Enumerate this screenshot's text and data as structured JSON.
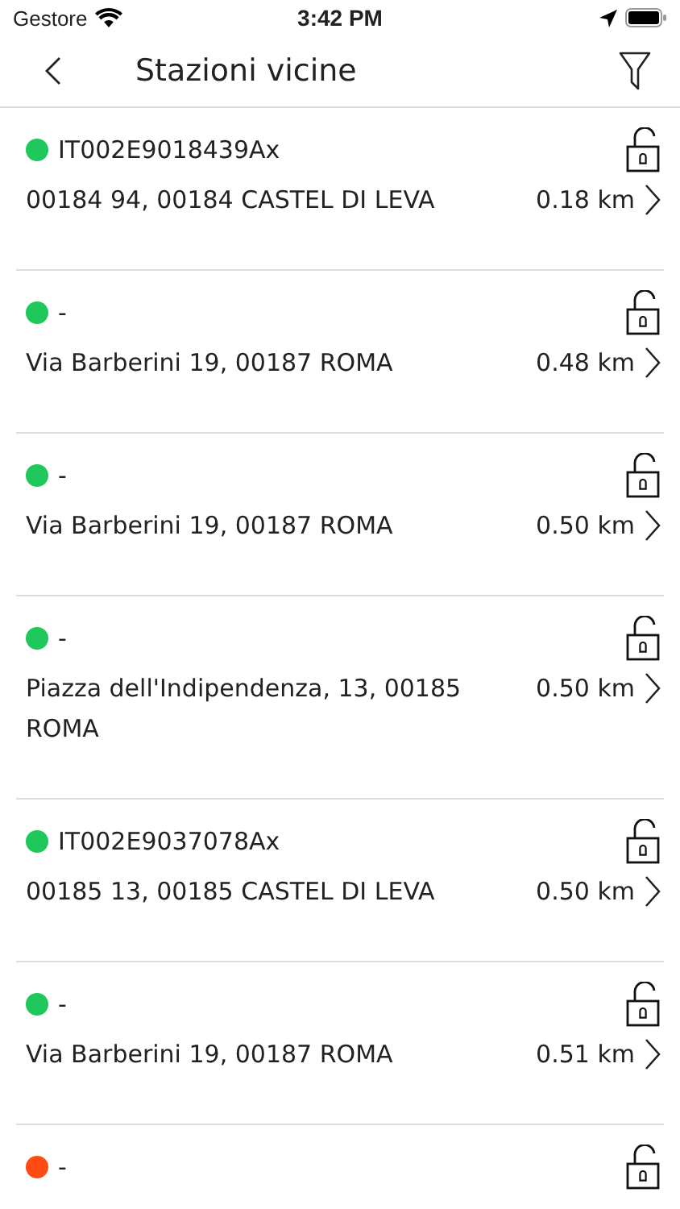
{
  "status_bar": {
    "carrier": "Gestore",
    "time": "3:42 PM"
  },
  "nav": {
    "title": "Stazioni vicine"
  },
  "stations": [
    {
      "name": "IT002E9018439Ax",
      "color": "#1ec85a",
      "address": "00184 94, 00184 CASTEL DI LEVA",
      "distance": "0.18 km"
    },
    {
      "name": "-",
      "color": "#1ec85a",
      "address": "Via Barberini 19, 00187 ROMA",
      "distance": "0.48 km"
    },
    {
      "name": "-",
      "color": "#1ec85a",
      "address": "Via Barberini 19, 00187 ROMA",
      "distance": "0.50 km"
    },
    {
      "name": "-",
      "color": "#1ec85a",
      "address": "Piazza dell'Indipendenza, 13, 00185 ROMA",
      "distance": "0.50 km"
    },
    {
      "name": "IT002E9037078Ax",
      "color": "#1ec85a",
      "address": "00185 13, 00185 CASTEL DI LEVA",
      "distance": "0.50 km"
    },
    {
      "name": "-",
      "color": "#1ec85a",
      "address": "Via Barberini 19, 00187 ROMA",
      "distance": "0.51 km"
    },
    {
      "name": "-",
      "color": "#ff4a14"
    }
  ]
}
